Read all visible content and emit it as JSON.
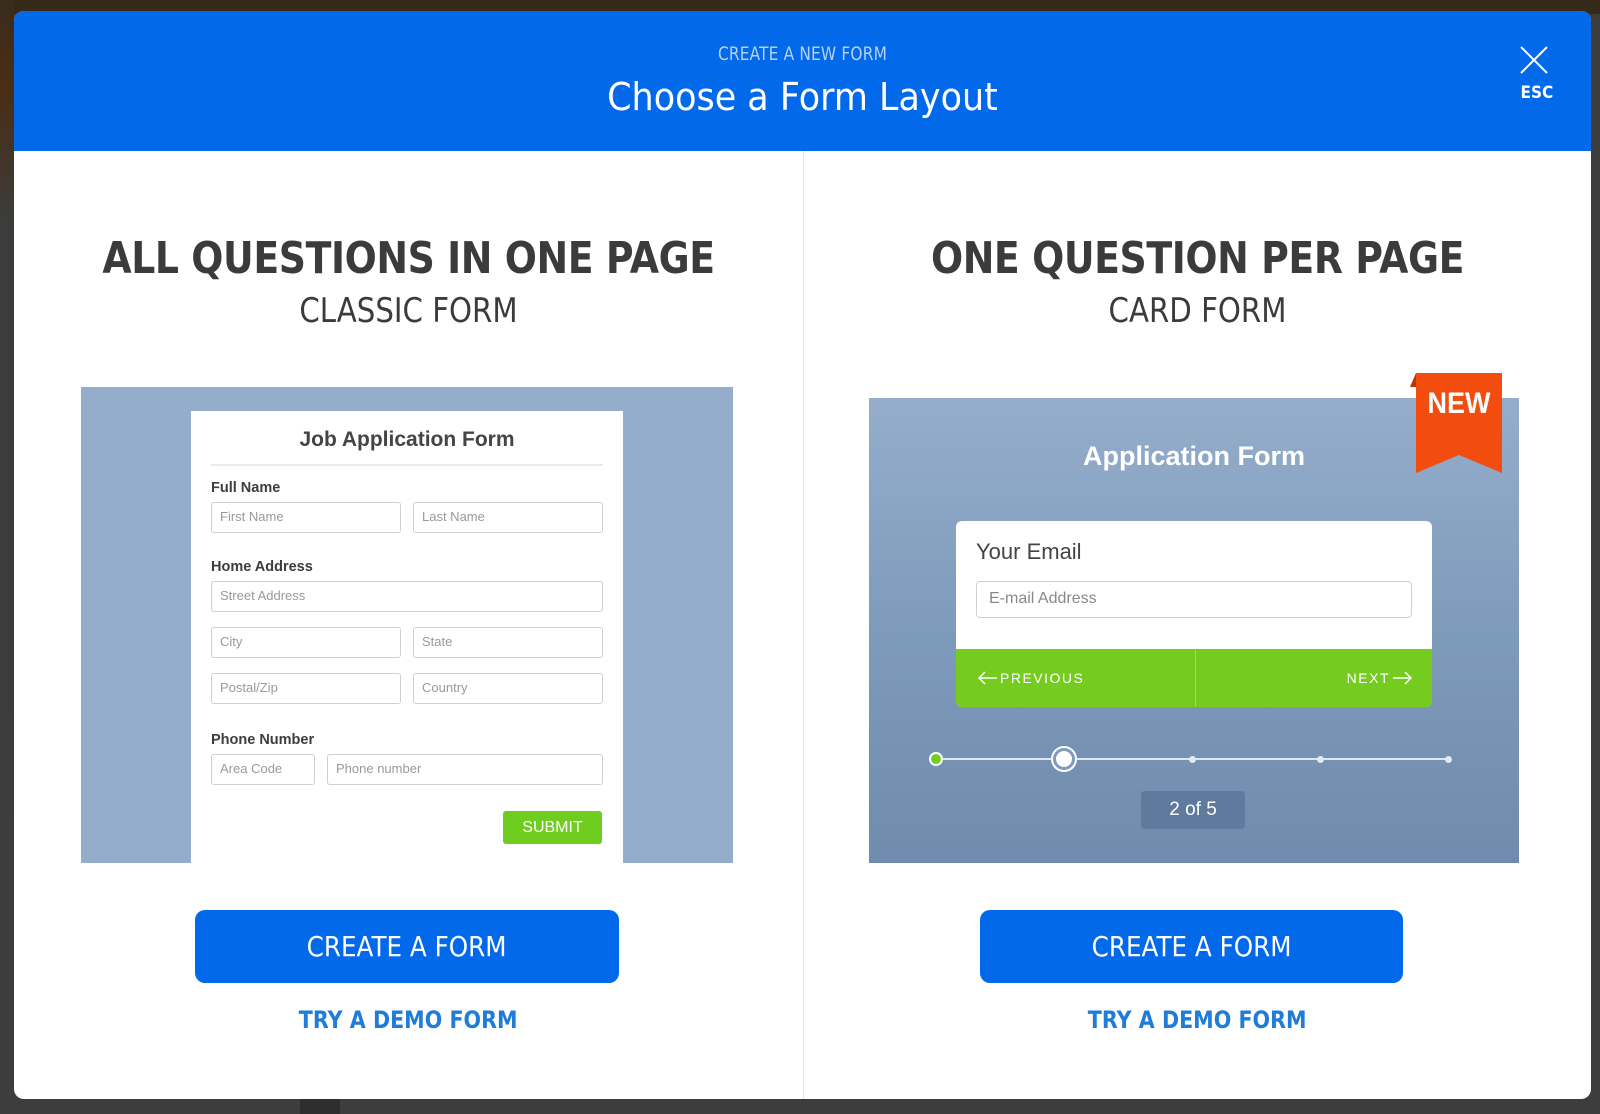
{
  "header": {
    "kicker": "CREATE A NEW FORM",
    "title": "Choose a Form Layout",
    "close_label": "ESC",
    "close_icon": "close-x-icon"
  },
  "colors": {
    "brand_blue": "#0369eb",
    "link_blue": "#1f7dd9",
    "green": "#74cc1f",
    "ribbon_orange": "#f24c0f",
    "preview_bg": "#94adcb"
  },
  "layouts": [
    {
      "heading": "ALL QUESTIONS IN ONE PAGE",
      "subheading": "CLASSIC FORM",
      "create_label": "CREATE A FORM",
      "demo_label": "TRY A DEMO FORM",
      "preview": {
        "title": "Job Application Form",
        "sections": [
          {
            "label": "Full Name",
            "fields": [
              "First Name",
              "Last Name"
            ]
          },
          {
            "label": "Home Address",
            "fields": [
              "Street Address",
              "City",
              "State",
              "Postal/Zip",
              "Country"
            ]
          },
          {
            "label": "Phone Number",
            "fields": [
              "Area Code",
              "Phone number"
            ]
          }
        ],
        "submit_label": "SUBMIT"
      }
    },
    {
      "heading": "ONE QUESTION PER PAGE",
      "subheading": "CARD FORM",
      "create_label": "CREATE A FORM",
      "demo_label": "TRY A DEMO FORM",
      "badge": "NEW",
      "preview": {
        "title": "Application Form",
        "question": "Your Email",
        "placeholder": "E-mail Address",
        "prev_label": "PREVIOUS",
        "next_label": "NEXT",
        "progress": {
          "current": 2,
          "total": 5
        },
        "counter": "2 of 5"
      }
    }
  ]
}
